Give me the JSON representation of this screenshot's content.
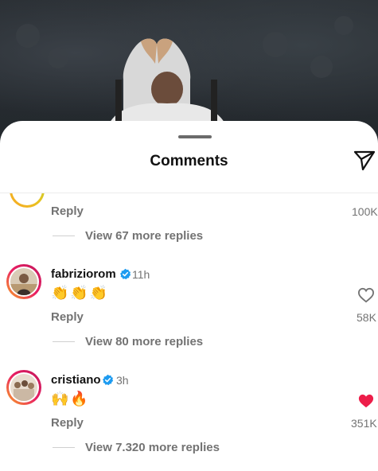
{
  "sheet": {
    "title": "Comments"
  },
  "comments": [
    {
      "reply_label": "Reply",
      "likes": "100K",
      "view_more": "View 67 more replies"
    },
    {
      "username": "fabriziorom",
      "time": "11h",
      "text": "👏👏👏",
      "reply_label": "Reply",
      "likes": "58K",
      "liked": false,
      "view_more": "View 80 more replies"
    },
    {
      "username": "cristiano",
      "time": "3h",
      "text": "🙌🔥",
      "reply_label": "Reply",
      "likes": "351K",
      "liked": true,
      "view_more": "View 7.320 more replies"
    }
  ],
  "colors": {
    "verified": "#1d9bf0",
    "like_active": "#ed1d49",
    "muted_text": "#737373"
  },
  "icons": {
    "share": "paper-plane-icon",
    "like_outline": "heart-outline-icon",
    "like_filled": "heart-filled-icon",
    "verified": "verified-badge-icon"
  }
}
